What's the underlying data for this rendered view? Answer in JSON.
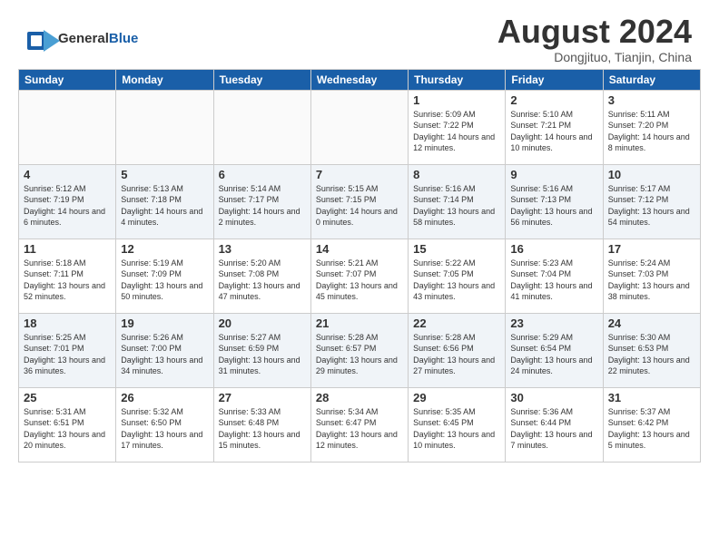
{
  "header": {
    "logo_general": "General",
    "logo_blue": "Blue",
    "month_year": "August 2024",
    "location": "Dongjituo, Tianjin, China"
  },
  "days_of_week": [
    "Sunday",
    "Monday",
    "Tuesday",
    "Wednesday",
    "Thursday",
    "Friday",
    "Saturday"
  ],
  "weeks": [
    [
      {
        "day": "",
        "empty": true
      },
      {
        "day": "",
        "empty": true
      },
      {
        "day": "",
        "empty": true
      },
      {
        "day": "",
        "empty": true
      },
      {
        "day": "1",
        "sunrise": "5:09 AM",
        "sunset": "7:22 PM",
        "daylight": "14 hours and 12 minutes."
      },
      {
        "day": "2",
        "sunrise": "5:10 AM",
        "sunset": "7:21 PM",
        "daylight": "14 hours and 10 minutes."
      },
      {
        "day": "3",
        "sunrise": "5:11 AM",
        "sunset": "7:20 PM",
        "daylight": "14 hours and 8 minutes."
      }
    ],
    [
      {
        "day": "4",
        "sunrise": "5:12 AM",
        "sunset": "7:19 PM",
        "daylight": "14 hours and 6 minutes."
      },
      {
        "day": "5",
        "sunrise": "5:13 AM",
        "sunset": "7:18 PM",
        "daylight": "14 hours and 4 minutes."
      },
      {
        "day": "6",
        "sunrise": "5:14 AM",
        "sunset": "7:17 PM",
        "daylight": "14 hours and 2 minutes."
      },
      {
        "day": "7",
        "sunrise": "5:15 AM",
        "sunset": "7:15 PM",
        "daylight": "14 hours and 0 minutes."
      },
      {
        "day": "8",
        "sunrise": "5:16 AM",
        "sunset": "7:14 PM",
        "daylight": "13 hours and 58 minutes."
      },
      {
        "day": "9",
        "sunrise": "5:16 AM",
        "sunset": "7:13 PM",
        "daylight": "13 hours and 56 minutes."
      },
      {
        "day": "10",
        "sunrise": "5:17 AM",
        "sunset": "7:12 PM",
        "daylight": "13 hours and 54 minutes."
      }
    ],
    [
      {
        "day": "11",
        "sunrise": "5:18 AM",
        "sunset": "7:11 PM",
        "daylight": "13 hours and 52 minutes."
      },
      {
        "day": "12",
        "sunrise": "5:19 AM",
        "sunset": "7:09 PM",
        "daylight": "13 hours and 50 minutes."
      },
      {
        "day": "13",
        "sunrise": "5:20 AM",
        "sunset": "7:08 PM",
        "daylight": "13 hours and 47 minutes."
      },
      {
        "day": "14",
        "sunrise": "5:21 AM",
        "sunset": "7:07 PM",
        "daylight": "13 hours and 45 minutes."
      },
      {
        "day": "15",
        "sunrise": "5:22 AM",
        "sunset": "7:05 PM",
        "daylight": "13 hours and 43 minutes."
      },
      {
        "day": "16",
        "sunrise": "5:23 AM",
        "sunset": "7:04 PM",
        "daylight": "13 hours and 41 minutes."
      },
      {
        "day": "17",
        "sunrise": "5:24 AM",
        "sunset": "7:03 PM",
        "daylight": "13 hours and 38 minutes."
      }
    ],
    [
      {
        "day": "18",
        "sunrise": "5:25 AM",
        "sunset": "7:01 PM",
        "daylight": "13 hours and 36 minutes."
      },
      {
        "day": "19",
        "sunrise": "5:26 AM",
        "sunset": "7:00 PM",
        "daylight": "13 hours and 34 minutes."
      },
      {
        "day": "20",
        "sunrise": "5:27 AM",
        "sunset": "6:59 PM",
        "daylight": "13 hours and 31 minutes."
      },
      {
        "day": "21",
        "sunrise": "5:28 AM",
        "sunset": "6:57 PM",
        "daylight": "13 hours and 29 minutes."
      },
      {
        "day": "22",
        "sunrise": "5:28 AM",
        "sunset": "6:56 PM",
        "daylight": "13 hours and 27 minutes."
      },
      {
        "day": "23",
        "sunrise": "5:29 AM",
        "sunset": "6:54 PM",
        "daylight": "13 hours and 24 minutes."
      },
      {
        "day": "24",
        "sunrise": "5:30 AM",
        "sunset": "6:53 PM",
        "daylight": "13 hours and 22 minutes."
      }
    ],
    [
      {
        "day": "25",
        "sunrise": "5:31 AM",
        "sunset": "6:51 PM",
        "daylight": "13 hours and 20 minutes."
      },
      {
        "day": "26",
        "sunrise": "5:32 AM",
        "sunset": "6:50 PM",
        "daylight": "13 hours and 17 minutes."
      },
      {
        "day": "27",
        "sunrise": "5:33 AM",
        "sunset": "6:48 PM",
        "daylight": "13 hours and 15 minutes."
      },
      {
        "day": "28",
        "sunrise": "5:34 AM",
        "sunset": "6:47 PM",
        "daylight": "13 hours and 12 minutes."
      },
      {
        "day": "29",
        "sunrise": "5:35 AM",
        "sunset": "6:45 PM",
        "daylight": "13 hours and 10 minutes."
      },
      {
        "day": "30",
        "sunrise": "5:36 AM",
        "sunset": "6:44 PM",
        "daylight": "13 hours and 7 minutes."
      },
      {
        "day": "31",
        "sunrise": "5:37 AM",
        "sunset": "6:42 PM",
        "daylight": "13 hours and 5 minutes."
      }
    ]
  ]
}
